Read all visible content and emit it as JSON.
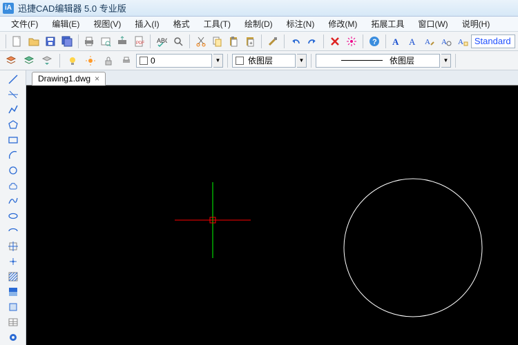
{
  "title": "迅捷CAD编辑器 5.0 专业版",
  "menu": [
    "文件(F)",
    "编辑(E)",
    "视图(V)",
    "插入(I)",
    "格式",
    "工具(T)",
    "绘制(D)",
    "标注(N)",
    "修改(M)",
    "拓展工具",
    "窗口(W)",
    "说明(H)"
  ],
  "style_text": "Standard",
  "layer_value": "0",
  "linetype_text": "依图层",
  "lineweight_text": "依图层",
  "tab_name": "Drawing1.dwg",
  "tab_close": "×"
}
